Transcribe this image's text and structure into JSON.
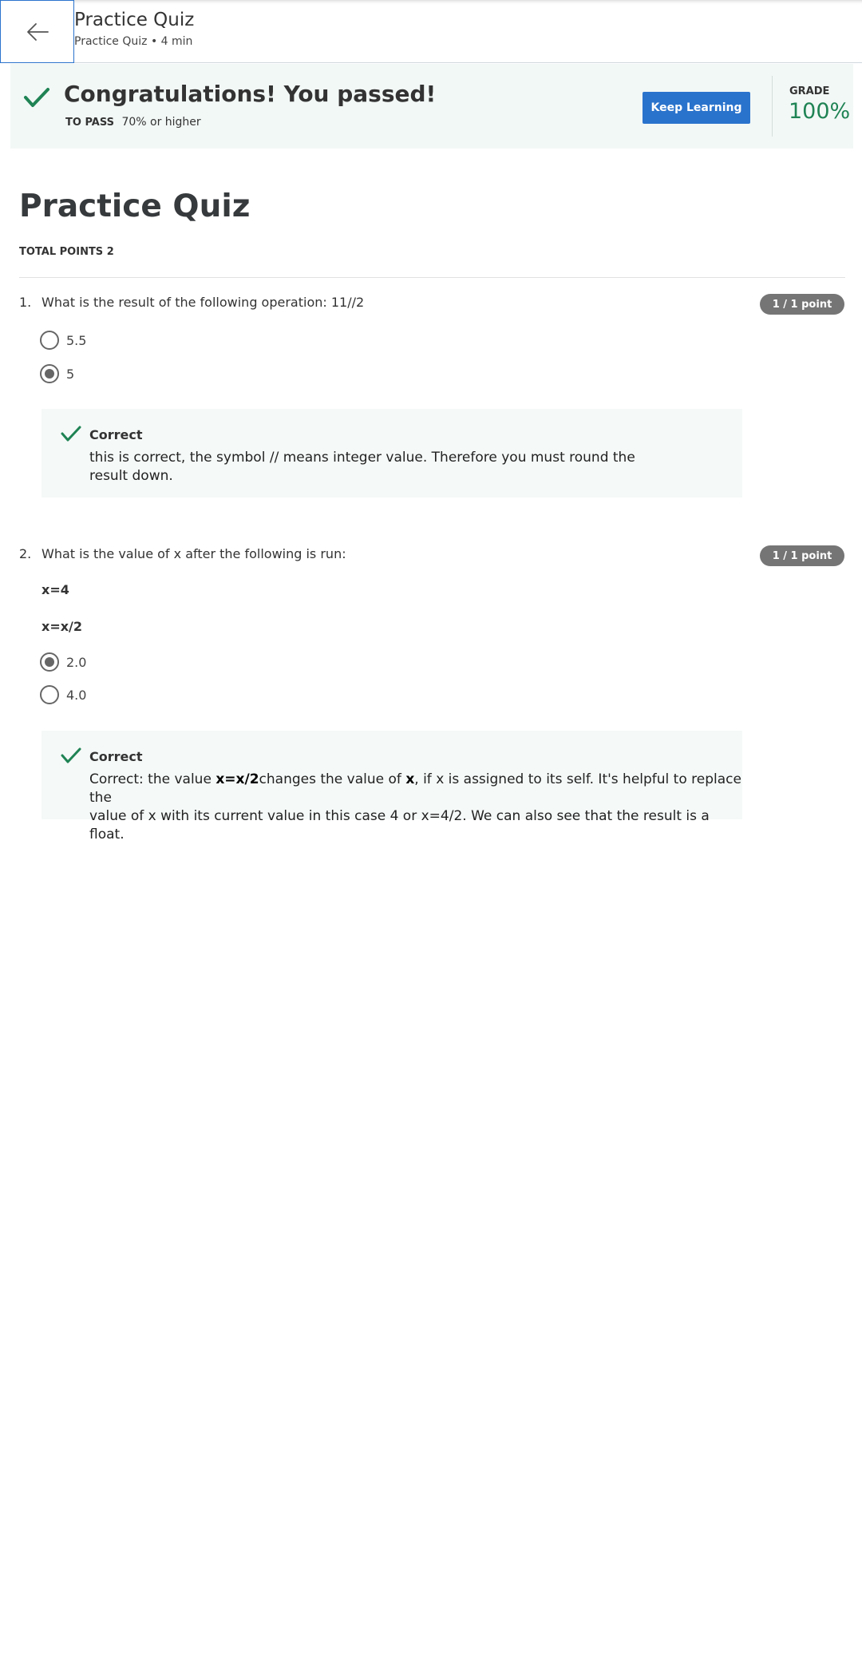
{
  "header": {
    "title": "Practice Quiz",
    "subtitle": "Practice Quiz • 4 min",
    "back_icon": "arrow-left-icon"
  },
  "result": {
    "title": "Congratulations! You passed!",
    "to_pass_label": "TO PASS",
    "to_pass_value": "70% or higher",
    "keep_learning_label": "Keep Learning",
    "grade_label": "GRADE",
    "grade_value": "100%",
    "icon": "checkmark-icon"
  },
  "quiz": {
    "title": "Practice Quiz",
    "total_points": "TOTAL POINTS 2"
  },
  "questions": [
    {
      "number": "1.",
      "text": "What is the result of the following operation:  11//2",
      "points": "1 / 1 point",
      "options": [
        {
          "label": "5.5",
          "selected": false
        },
        {
          "label": "5",
          "selected": true
        }
      ],
      "feedback": {
        "title": "Correct",
        "line1": "this is correct, the symbol // means integer value. Therefore you must round the",
        "line2": "result down."
      }
    },
    {
      "number": "2.",
      "text": "What is the value of x after the following is run:",
      "points": "1 / 1 point",
      "code": [
        "x=4",
        "x=x/2"
      ],
      "options": [
        {
          "label": "2.0",
          "selected": true
        },
        {
          "label": "4.0",
          "selected": false
        }
      ],
      "feedback": {
        "title": "Correct",
        "part1": "Correct: the value ",
        "bold1": "x=x/2",
        "part2": "changes the value of ",
        "bold2": "x",
        "part3": ", if x is assigned to its self. It's helpful to replace the",
        "line2": "value of x with its current value in this case 4 or x=4/2. We can also see that the result is a float."
      }
    }
  ],
  "colors": {
    "accent_blue": "#2a73cc",
    "success_green": "#1f8354",
    "banner_bg": "#f2f8f6",
    "badge_gray": "#757575"
  }
}
